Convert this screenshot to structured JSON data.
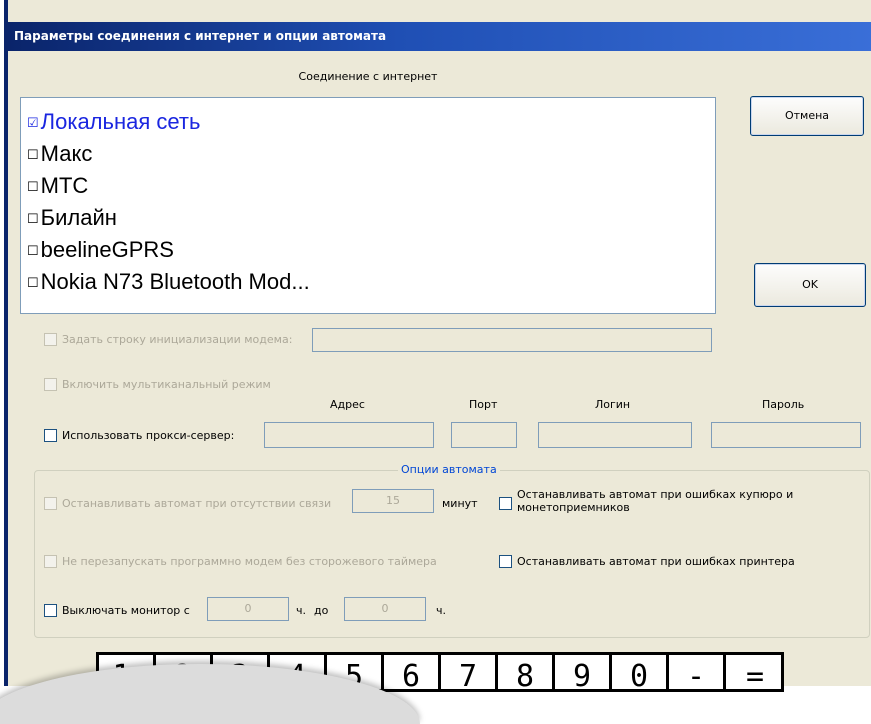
{
  "window": {
    "title": "Параметры соединения с интернет и опции автомата"
  },
  "connection": {
    "caption": "Соединение с интернет",
    "items": [
      {
        "label": "Локальная сеть",
        "checked": true
      },
      {
        "label": "Макс",
        "checked": false
      },
      {
        "label": "МТС",
        "checked": false
      },
      {
        "label": "Билайн",
        "checked": false
      },
      {
        "label": "beelineGPRS",
        "checked": false
      },
      {
        "label": "Nokia N73 Bluetooth Mod...",
        "checked": false
      }
    ],
    "checked_glyph": "☑",
    "unchecked_glyph": "☐"
  },
  "buttons": {
    "cancel": "Отмена",
    "ok": "OK"
  },
  "modem": {
    "init_string_label": "Задать строку инициализации модема:",
    "init_string_value": "",
    "multichannel_label": "Включить мультиканальный режим"
  },
  "proxy": {
    "label": "Использовать прокси-сервер:",
    "headers": {
      "address": "Адрес",
      "port": "Порт",
      "login": "Логин",
      "password": "Пароль"
    },
    "values": {
      "address": "",
      "port": "",
      "login": "",
      "password": ""
    }
  },
  "options": {
    "caption": "Опции автомата",
    "stop_no_link_label": "Останавливать автомат при отсутствии связи",
    "stop_no_link_minutes": "15",
    "minutes_unit": "минут",
    "stop_bill_errors_label": "Останавливать автомат при ошибках купюро и монетоприемников",
    "no_restart_modem_label": "Не перезапускать программно модем  без сторожевого таймера",
    "stop_printer_errors_label": "Останавливать автомат при ошибках принтера",
    "monitor_off_label": "Выключать монитор с",
    "monitor_from": "0",
    "hours_unit": "ч.",
    "to_label": "до",
    "monitor_to": "0",
    "hours_unit_2": "ч."
  },
  "keyboard": {
    "keys": [
      "1",
      "2",
      "3",
      "4",
      "5",
      "6",
      "7",
      "8",
      "9",
      "0",
      "-",
      "="
    ]
  },
  "colors": {
    "selected_item": "#1a26e0",
    "group_caption": "#0046d5",
    "titlebar": "#0a246a"
  }
}
